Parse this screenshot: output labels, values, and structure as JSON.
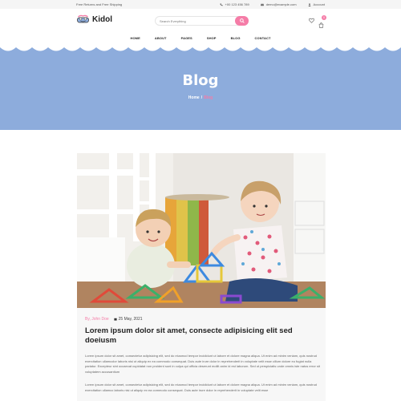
{
  "topbar": {
    "shipping": "Free Returns and Free Shipping",
    "phone": "+00 123 456 789",
    "email": "demo@example.com",
    "account": "Account"
  },
  "header": {
    "logo_text": "Kidol",
    "search_placeholder": "Search Everything",
    "cart_count": "0"
  },
  "nav": {
    "items": [
      "HOME",
      "ABOUT",
      "PAGES",
      "SHOP",
      "BLOG",
      "CONTACT"
    ]
  },
  "banner": {
    "title": "Blog",
    "crumb_home": "Home",
    "crumb_sep": "/",
    "crumb_current": "Blog",
    "bg_color": "#8dacdc",
    "accent_color": "#f57ca7"
  },
  "post": {
    "author": "By, John Doe",
    "date": "25 May, 2021",
    "title": "Lorem ipsum dolor sit amet, consecte adipisicing elit sed doeiusm",
    "para1": "Lorem ipsum dolor sit amet, consectetur adipisicing elit, sed do eiusmod tempor incididunt ut labore et dolore magna aliqua. Ut enim ad minim veniam, quis nostrud exercitation ullamcolor laboris nisi ut aliquip ex ea commodo consequat. Duis aute irure dolor in reprehenderit in voluptate velit esse cillum dolore eu fugiat nulla pariatur. Excepteur sint occaecat cupidatat non proident sunt in culpa qui officia deserunt mollit anim id est laborum. Sed ut perspiciatis unde omnis iste natus error sit voluptatem accusantium",
    "para2": "Lorem ipsum dolor sit amet, consectetur adipisicing elit, sed do eiusmod tempor incididunt ut labore et dolore magna aliqua. Ut enim ad minim veniam, quis nostrud exercitation ullamco laboris nisi ut aliquip ex ea commodo consequat. Duis aute irure dolor in reprehenderit in voluptate velit esse"
  }
}
